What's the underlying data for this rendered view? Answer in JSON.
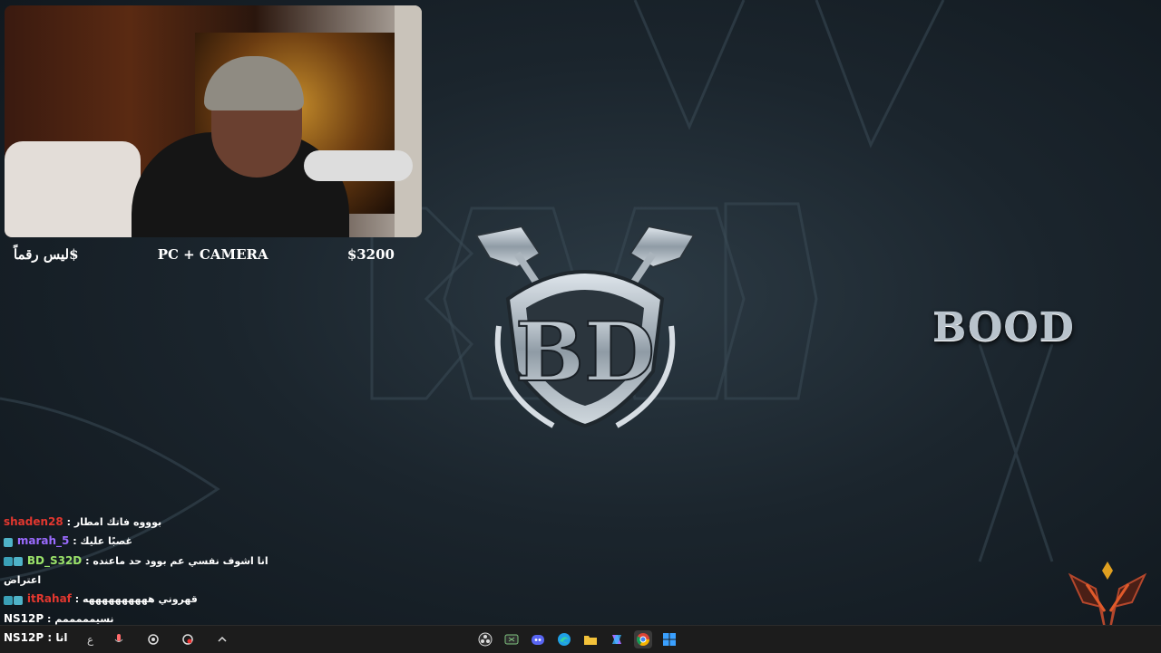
{
  "donation": {
    "left_label": "ليس رقماً$",
    "center_label": "PC + CAMERA",
    "amount": "$3200"
  },
  "brand": {
    "name": "BOOD",
    "logo_letters": "BD"
  },
  "chat": {
    "messages": [
      {
        "user": "shaden28",
        "user_color": "#e2372f",
        "badges": [],
        "text": "بوووه فاتك امطار"
      },
      {
        "user": "marah_5",
        "user_color": "#9b6bff",
        "badges": [
          "sub"
        ],
        "text": "غصبًا عليك"
      },
      {
        "user": "BD_S32D",
        "user_color": "#9be36a",
        "badges": [
          "mod",
          "sub"
        ],
        "text": "انا اشوف نفسي عم بوود حد ماعنده",
        "continuation": "اعتراض"
      },
      {
        "user": "itRahaf",
        "user_color": "#e2372f",
        "badges": [
          "mod",
          "sub"
        ],
        "text": "قهروني ههههههههههه"
      },
      {
        "user": "NS12P",
        "user_color": "#ffffff",
        "badges": [],
        "text": "نسيمممممم"
      },
      {
        "user": "NS12P",
        "user_color": "#ffffff",
        "badges": [],
        "text": "انا"
      }
    ]
  },
  "taskbar": {
    "left_items": [
      "ع",
      "mic-icon",
      "network-icon",
      "record-icon",
      "chevron-up-icon"
    ],
    "center_apps": [
      "obs-icon",
      "xbox-icon",
      "discord-icon",
      "edge-icon",
      "file-explorer-icon",
      "copilot-icon",
      "chrome-icon",
      "windows-start-icon"
    ]
  },
  "colors": {
    "background": "#1b252d",
    "taskbar": "#1c1c1c",
    "emblem_accent": "#e0a020"
  }
}
